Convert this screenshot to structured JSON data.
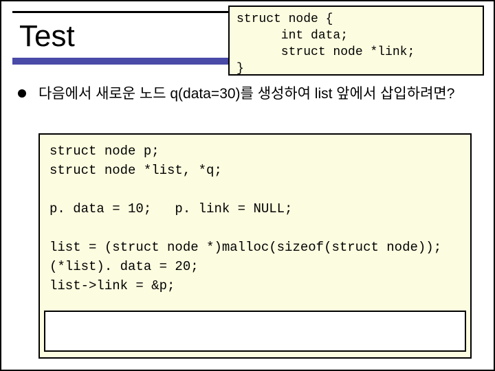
{
  "title": "Test",
  "struct_def": {
    "l1": "struct node {",
    "l2": "      int data;",
    "l3": "      struct node *link;",
    "l4": "}"
  },
  "bullet": "다음에서 새로운 노드 q(data=30)를 생성하여 list 앞에서 삽입하려면?",
  "code": {
    "l1": "struct node p;",
    "l2": "struct node *list, *q;",
    "l3": "",
    "l4": "p. data = 10;   p. link = NULL;",
    "l5": "",
    "l6": "list = (struct node *)malloc(sizeof(struct node));",
    "l7": "(*list). data = 20;",
    "l8": "list->link = &p;"
  }
}
